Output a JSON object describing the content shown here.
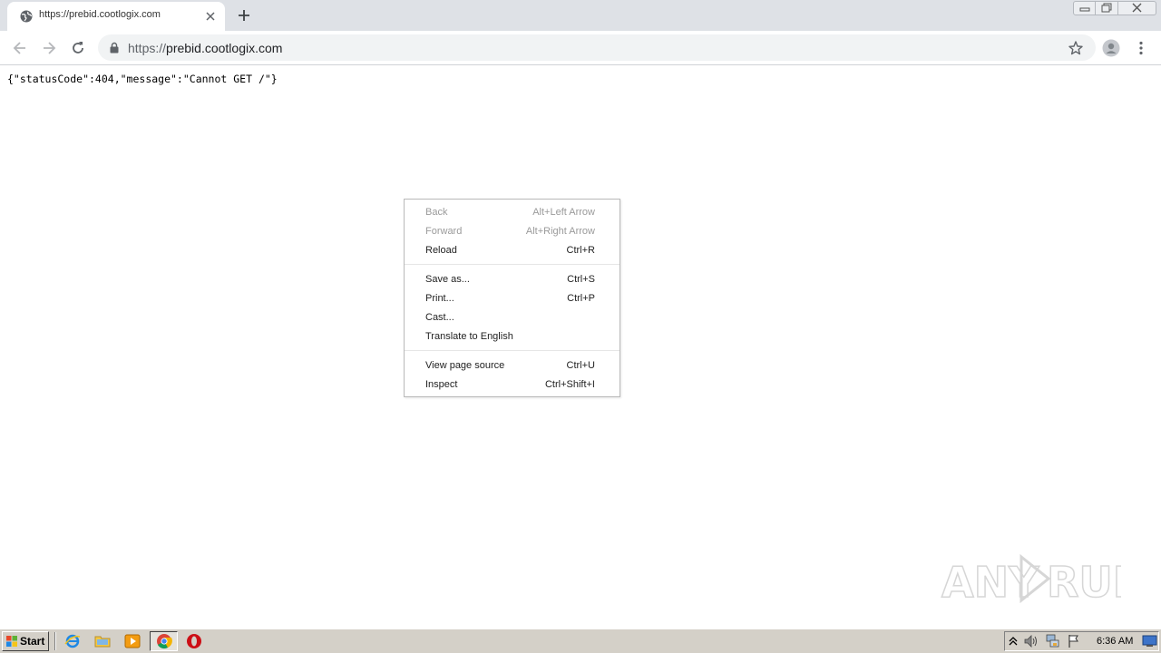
{
  "browser": {
    "tab": {
      "title": "https://prebid.cootlogix.com",
      "favicon": "globe-icon"
    },
    "omnibox": {
      "url_scheme": "https://",
      "url_host": "prebid.cootlogix.com"
    }
  },
  "page": {
    "body_text": "{\"statusCode\":404,\"message\":\"Cannot GET /\"}"
  },
  "context_menu": {
    "items": [
      {
        "label": "Back",
        "shortcut": "Alt+Left Arrow",
        "enabled": false
      },
      {
        "label": "Forward",
        "shortcut": "Alt+Right Arrow",
        "enabled": false
      },
      {
        "label": "Reload",
        "shortcut": "Ctrl+R",
        "enabled": true
      },
      {
        "label": "Save as...",
        "shortcut": "Ctrl+S",
        "enabled": true
      },
      {
        "label": "Print...",
        "shortcut": "Ctrl+P",
        "enabled": true
      },
      {
        "label": "Cast...",
        "shortcut": "",
        "enabled": true
      },
      {
        "label": "Translate to English",
        "shortcut": "",
        "enabled": true
      },
      {
        "label": "View page source",
        "shortcut": "Ctrl+U",
        "enabled": true
      },
      {
        "label": "Inspect",
        "shortcut": "Ctrl+Shift+I",
        "enabled": true
      }
    ]
  },
  "watermark": {
    "text_left": "ANY",
    "text_right": "RUN"
  },
  "taskbar": {
    "start_label": "Start",
    "pinned": [
      "internet-explorer-icon",
      "folder-icon",
      "media-player-icon",
      "chrome-icon",
      "opera-icon"
    ],
    "tray_icons": [
      "chevron-up-icon",
      "speaker-icon",
      "network-icon",
      "flag-icon",
      "desktop-icon"
    ],
    "clock": "6:36 AM"
  },
  "colors": {
    "tabstrip_bg": "#dee1e6",
    "omnibox_bg": "#f1f3f4",
    "taskbar_bg": "#d4d0c8",
    "disabled_text": "#9a9a9a"
  }
}
